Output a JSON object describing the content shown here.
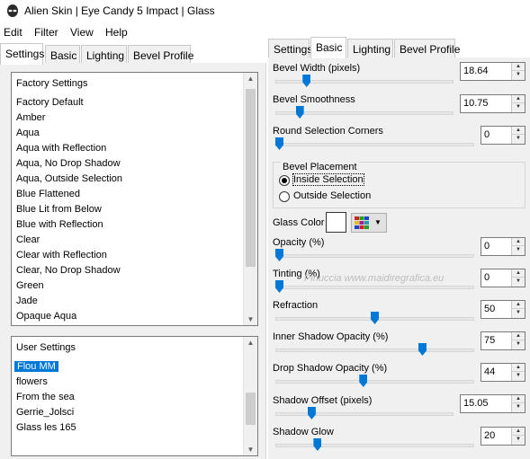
{
  "window": {
    "title": "Alien Skin | Eye Candy 5 Impact | Glass",
    "icon": "alien-skin-icon"
  },
  "menu": [
    "Edit",
    "Filter",
    "View",
    "Help"
  ],
  "left_tabs": [
    "Settings",
    "Basic",
    "Lighting",
    "Bevel Profile"
  ],
  "left_active_tab": "Settings",
  "factory_settings": {
    "header": "Factory Settings",
    "items": [
      "Factory Default",
      "Amber",
      "Aqua",
      "Aqua with Reflection",
      "Aqua, No Drop Shadow",
      "Aqua, Outside Selection",
      "Blue Flattened",
      "Blue Lit from Below",
      "Blue with Reflection",
      "Clear",
      "Clear with Reflection",
      "Clear, No Drop Shadow",
      "Green",
      "Jade",
      "Opaque Aqua"
    ]
  },
  "user_settings": {
    "header": "User Settings",
    "items": [
      "Flou MM",
      "flowers",
      "From the sea",
      "Gerrie_Jolsci",
      "Glass les 165"
    ],
    "selected": "Flou MM"
  },
  "right_tabs": [
    "Settings",
    "Basic",
    "Lighting",
    "Bevel Profile"
  ],
  "right_active_tab": "Basic",
  "basic": {
    "bevel_width": {
      "label": "Bevel Width (pixels)",
      "value": "18.64",
      "level": 0.16
    },
    "bevel_smoothness": {
      "label": "Bevel Smoothness",
      "value": "10.75",
      "level": 0.12
    },
    "round_corners": {
      "label": "Round Selection Corners",
      "value": "0",
      "level": 0.0
    },
    "bevel_placement": {
      "label": "Bevel Placement",
      "options": [
        "Inside Selection",
        "Outside Selection"
      ],
      "selected": "Inside Selection"
    },
    "glass_color": {
      "label": "Glass Color",
      "color": "#ffffff"
    },
    "opacity": {
      "label": "Opacity (%)",
      "value": "0",
      "level": 0.0
    },
    "tinting": {
      "label": "Tinting (%)",
      "value": "0",
      "level": 0.0
    },
    "refraction": {
      "label": "Refraction",
      "value": "50",
      "level": 0.5
    },
    "inner_shadow_opacity": {
      "label": "Inner Shadow Opacity (%)",
      "value": "75",
      "level": 0.75
    },
    "drop_shadow_opacity": {
      "label": "Drop Shadow Opacity (%)",
      "value": "44",
      "level": 0.44
    },
    "shadow_offset": {
      "label": "Shadow Offset (pixels)",
      "value": "15.05",
      "level": 0.19
    },
    "shadow_glow": {
      "label": "Shadow Glow",
      "value": "20",
      "level": 0.2
    }
  },
  "watermark": "Pinuccia www.maidiregrafica.eu",
  "colors": {
    "accent": "#0078d7",
    "panel": "#f0f0f0"
  }
}
